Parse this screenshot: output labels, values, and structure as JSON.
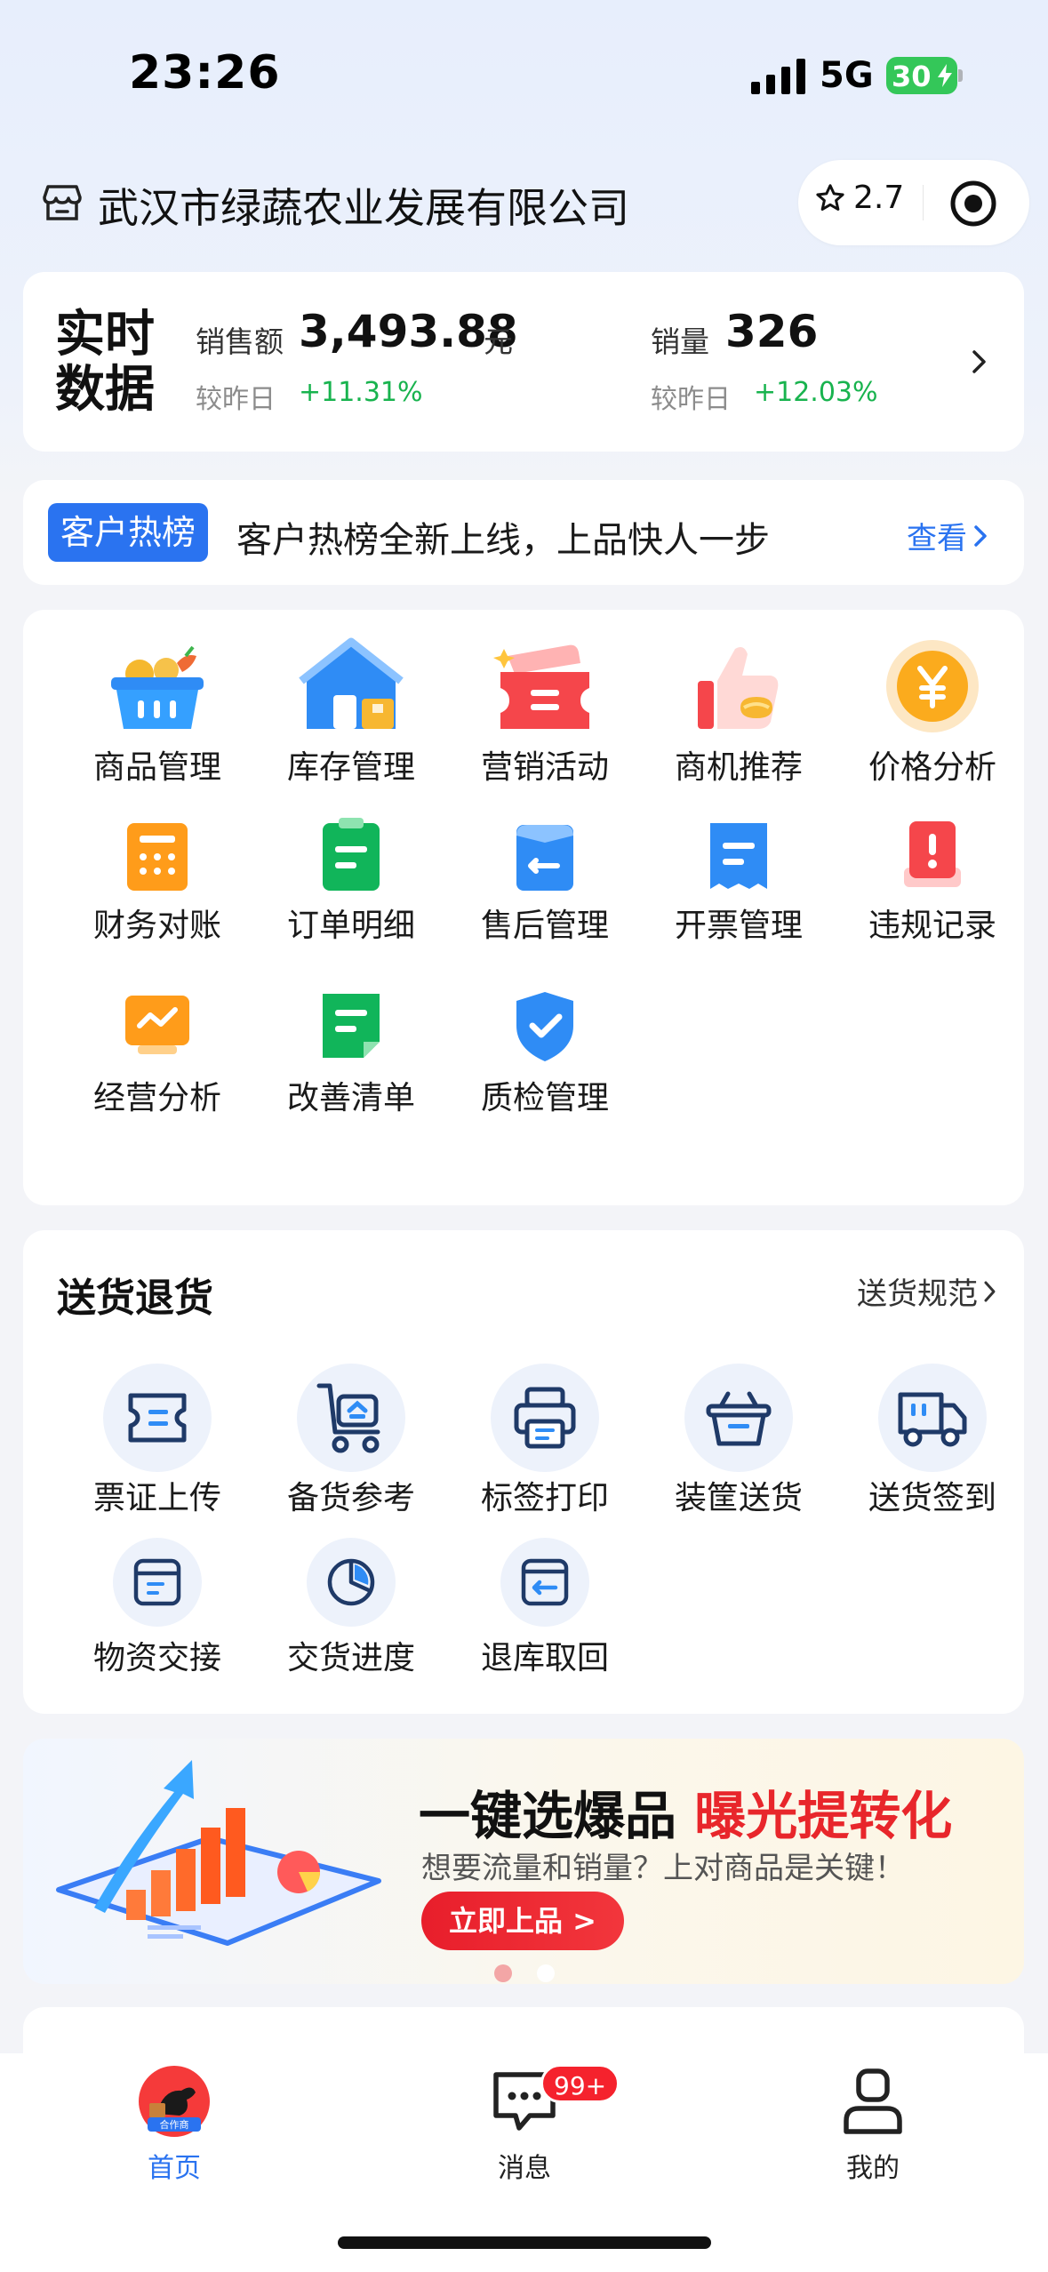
{
  "status_bar": {
    "time": "23:26",
    "network": "5G",
    "battery": "30"
  },
  "header": {
    "company": "武汉市绿蔬农业发展有限公司",
    "rating": "2.7"
  },
  "realtime": {
    "title": "实时数据",
    "sales_label": "销售额",
    "sales_value": "3,493.88",
    "sales_unit": "元",
    "sales_compare_label": "较昨日",
    "sales_compare_value": "+11.31%",
    "volume_label": "销量",
    "volume_value": "326",
    "volume_compare_label": "较昨日",
    "volume_compare_value": "+12.03%"
  },
  "hot_banner": {
    "badge": "客户热榜",
    "text": "客户热榜全新上线，上品快人一步",
    "link": "查看"
  },
  "tools": [
    {
      "label": "商品管理",
      "icon": "basket-icon"
    },
    {
      "label": "库存管理",
      "icon": "warehouse-icon"
    },
    {
      "label": "营销活动",
      "icon": "ticket-icon"
    },
    {
      "label": "商机推荐",
      "icon": "thumbs-up-icon"
    },
    {
      "label": "价格分析",
      "icon": "yen-coin-icon"
    },
    {
      "label": "财务对账",
      "icon": "calculator-icon"
    },
    {
      "label": "订单明细",
      "icon": "order-doc-icon"
    },
    {
      "label": "售后管理",
      "icon": "after-sales-icon"
    },
    {
      "label": "开票管理",
      "icon": "invoice-icon"
    },
    {
      "label": "违规记录",
      "icon": "violation-icon"
    },
    {
      "label": "经营分析",
      "icon": "trend-chart-icon"
    },
    {
      "label": "改善清单",
      "icon": "checklist-icon"
    },
    {
      "label": "质检管理",
      "icon": "shield-check-icon"
    }
  ],
  "delivery": {
    "title": "送货退货",
    "link": "送货规范",
    "items": [
      {
        "label": "票证上传",
        "icon": "voucher-icon"
      },
      {
        "label": "备货参考",
        "icon": "cart-icon"
      },
      {
        "label": "标签打印",
        "icon": "printer-icon"
      },
      {
        "label": "装筐送货",
        "icon": "basket-outline-icon"
      },
      {
        "label": "送货签到",
        "icon": "truck-icon"
      },
      {
        "label": "物资交接",
        "icon": "box-icon"
      },
      {
        "label": "交货进度",
        "icon": "pie-progress-icon"
      },
      {
        "label": "退库取回",
        "icon": "return-icon"
      }
    ]
  },
  "promo": {
    "headline_a": "一键选爆品",
    "headline_b": "曝光提转化",
    "sub": "想要流量和销量？上对商品是关键！",
    "button": "立即上品 >"
  },
  "tabbar": {
    "home": "首页",
    "home_avatar_text": "合作商",
    "messages": "消息",
    "messages_badge": "99+",
    "mine": "我的"
  },
  "colors": {
    "accent": "#2a73f0",
    "positive": "#18b34e",
    "promo_red": "#e8262b",
    "tab_active": "#2a73f0"
  }
}
